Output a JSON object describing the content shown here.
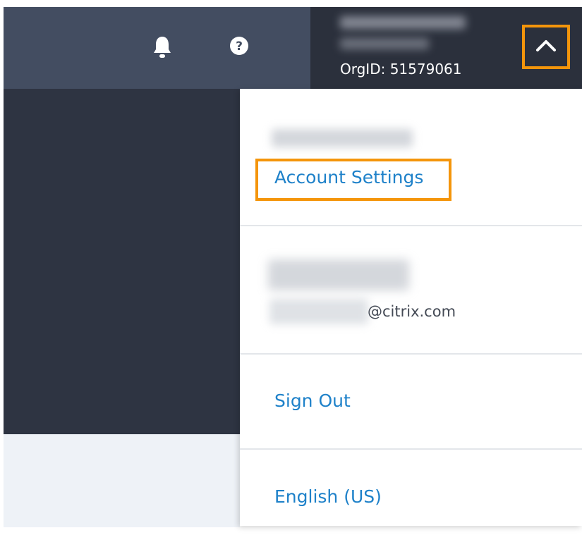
{
  "header": {
    "org_id": "OrgID: 51579061"
  },
  "account_menu": {
    "account_settings_label": "Account Settings",
    "email_domain": "@citrix.com",
    "sign_out_label": "Sign Out",
    "language_label": "English (US)"
  },
  "icons": {
    "notifications": "bell-icon",
    "help": "question-icon",
    "collapse_menu": "chevron-up-icon"
  },
  "colors": {
    "header_left": "#434d61",
    "header_right": "#2b303c",
    "sidebar": "#2e3442",
    "link": "#1e81c9",
    "highlight": "#f4950b"
  }
}
